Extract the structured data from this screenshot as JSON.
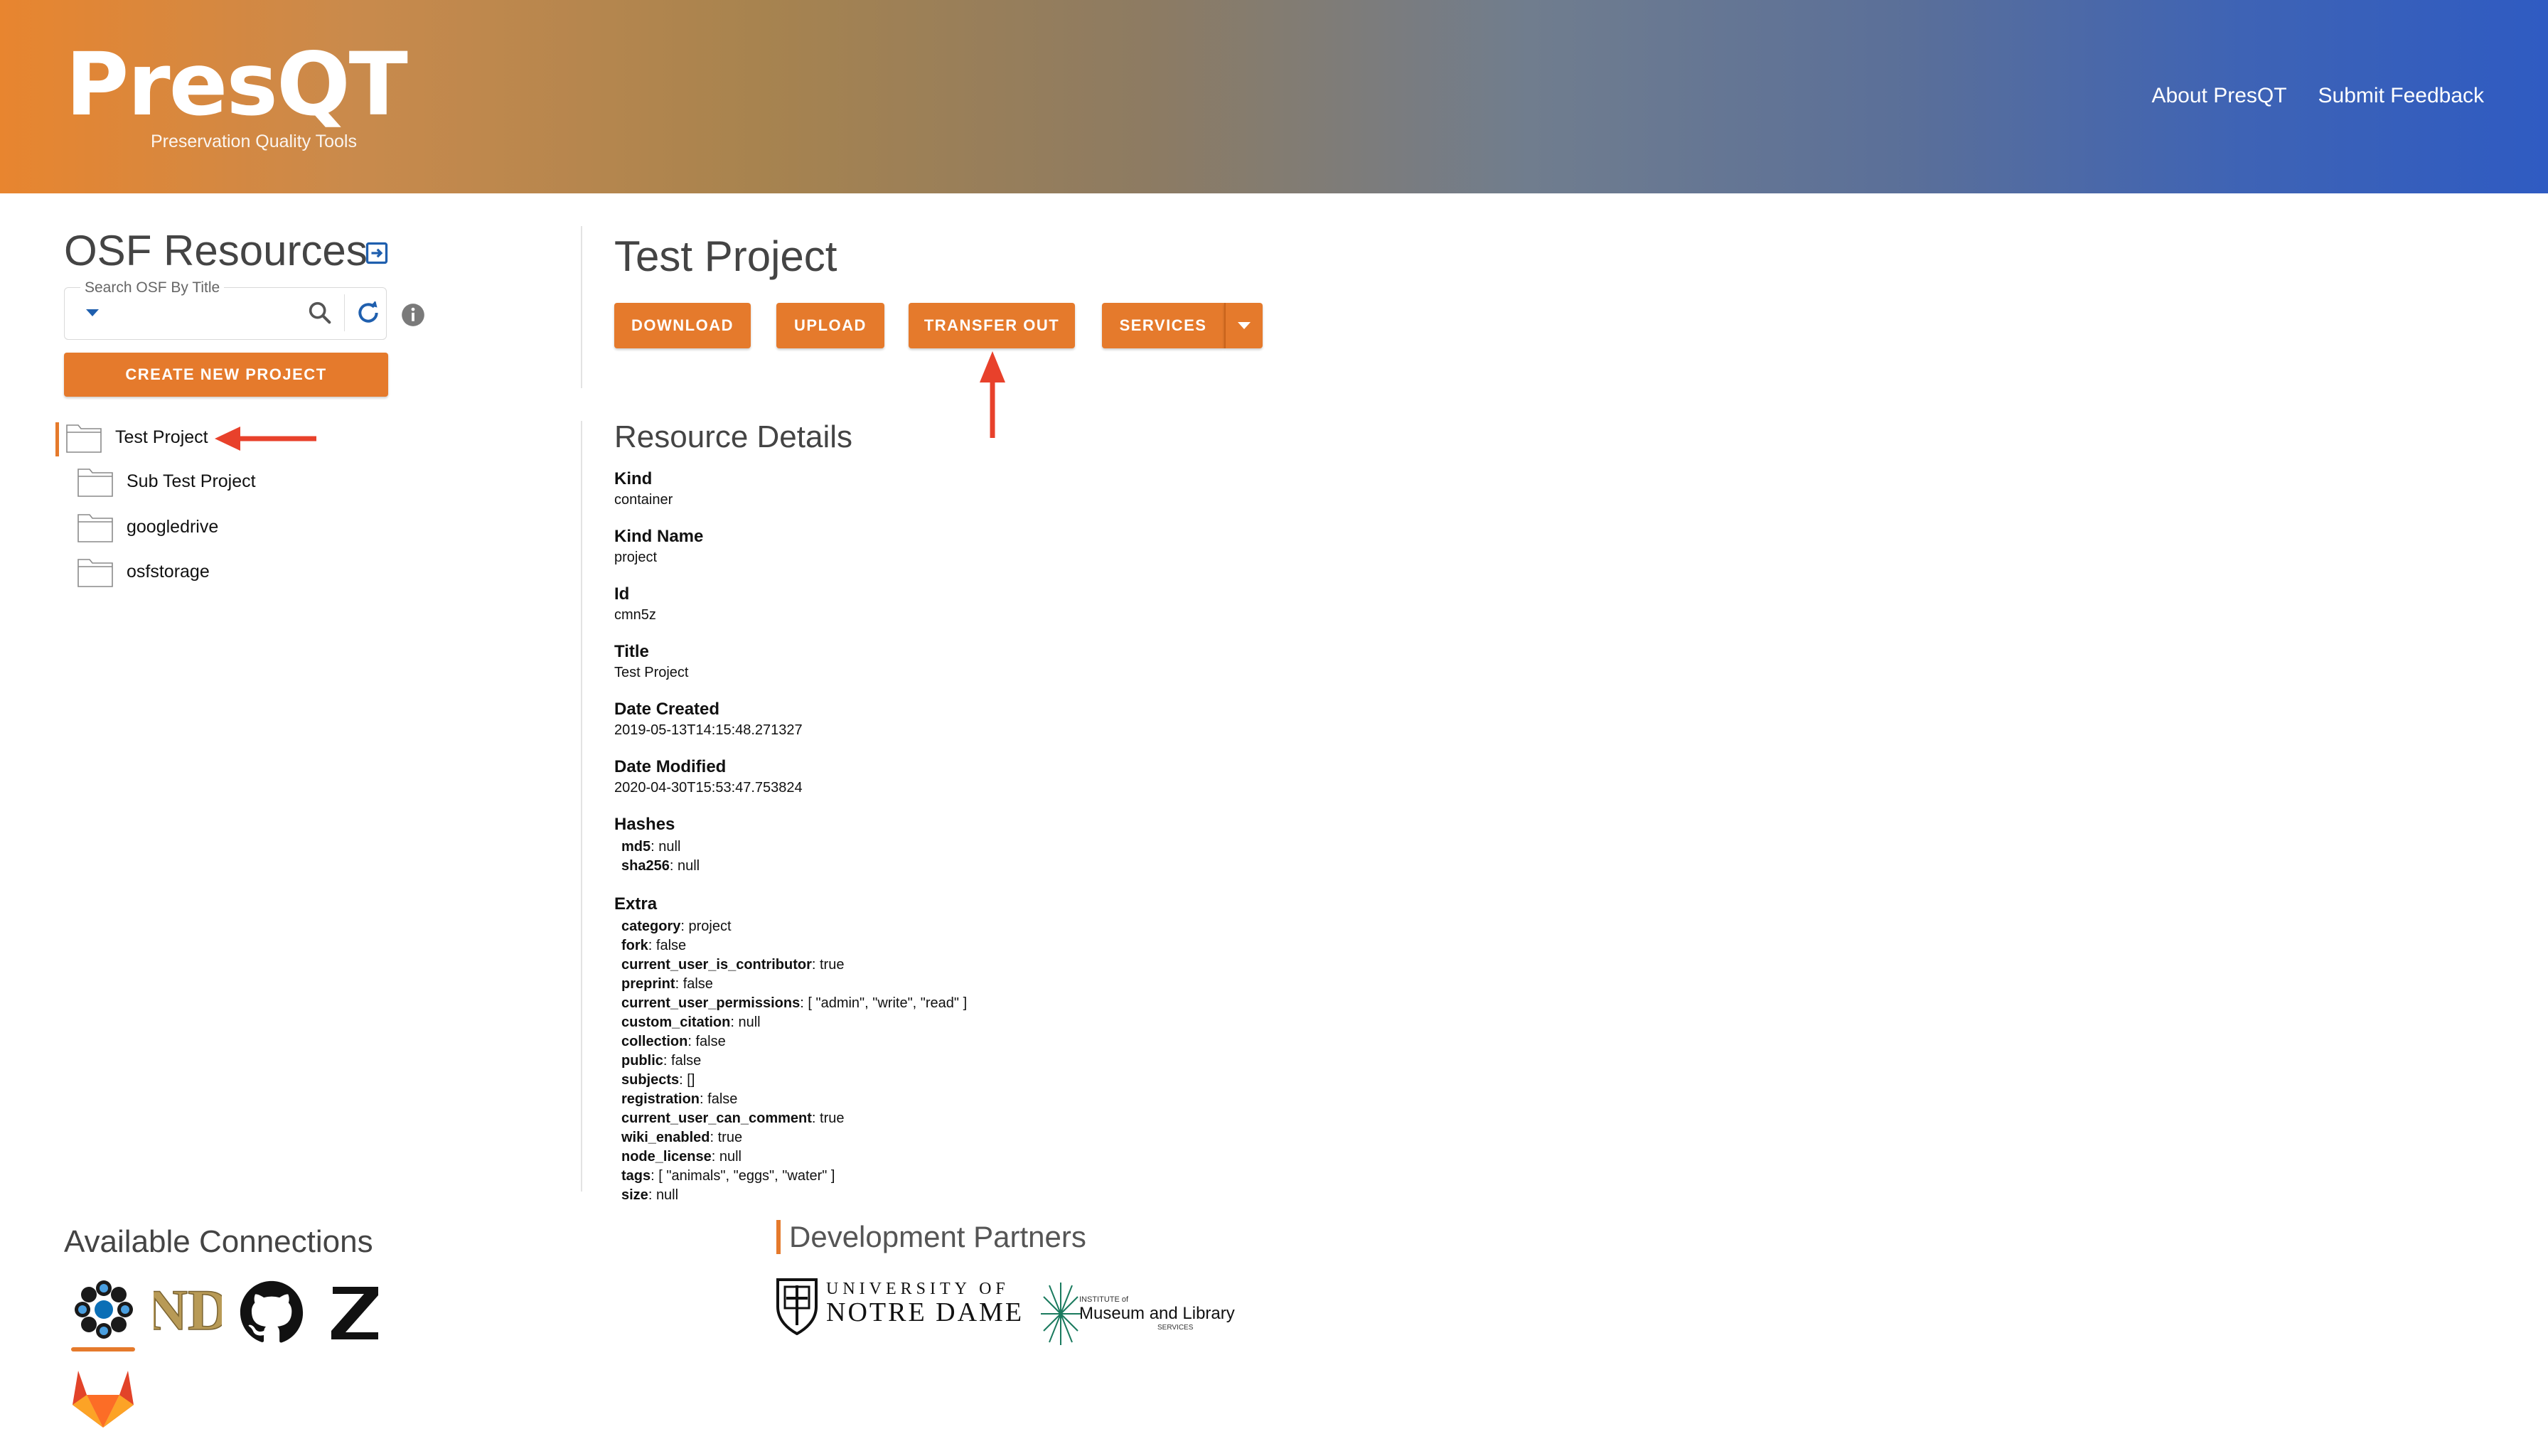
{
  "header": {
    "logo_title": "PresQT",
    "logo_subtitle": "Preservation Quality Tools",
    "nav": [
      "About PresQT",
      "Submit Feedback"
    ]
  },
  "sidebar": {
    "title": "OSF Resources",
    "search_label": "Search OSF By Title",
    "search_placeholder": "",
    "create_button": "CREATE NEW PROJECT",
    "tree": [
      {
        "label": "Test Project",
        "active": true,
        "level": 0
      },
      {
        "label": "Sub Test Project",
        "active": false,
        "level": 1
      },
      {
        "label": "googledrive",
        "active": false,
        "level": 1
      },
      {
        "label": "osfstorage",
        "active": false,
        "level": 1
      }
    ]
  },
  "main": {
    "title": "Test Project",
    "actions": [
      "DOWNLOAD",
      "UPLOAD",
      "TRANSFER OUT",
      "SERVICES"
    ],
    "details_title": "Resource Details",
    "details": [
      {
        "label": "Kind",
        "value": "container"
      },
      {
        "label": "Kind Name",
        "value": "project"
      },
      {
        "label": "Id",
        "value": "cmn5z"
      },
      {
        "label": "Title",
        "value": "Test Project"
      },
      {
        "label": "Date Created",
        "value": "2019-05-13T14:15:48.271327"
      },
      {
        "label": "Date Modified",
        "value": "2020-04-30T15:53:47.753824"
      }
    ],
    "hashes_label": "Hashes",
    "hashes": [
      {
        "key": "md5",
        "value": "null"
      },
      {
        "key": "sha256",
        "value": "null"
      }
    ],
    "extra_label": "Extra",
    "extra": [
      {
        "key": "category",
        "value": "project"
      },
      {
        "key": "fork",
        "value": "false"
      },
      {
        "key": "current_user_is_contributor",
        "value": "true"
      },
      {
        "key": "preprint",
        "value": "false"
      },
      {
        "key": "current_user_permissions",
        "value": "[ \"admin\", \"write\", \"read\" ]"
      },
      {
        "key": "custom_citation",
        "value": "null"
      },
      {
        "key": "collection",
        "value": "false"
      },
      {
        "key": "public",
        "value": "false"
      },
      {
        "key": "subjects",
        "value": "[]"
      },
      {
        "key": "registration",
        "value": "false"
      },
      {
        "key": "current_user_can_comment",
        "value": "true"
      },
      {
        "key": "wiki_enabled",
        "value": "true"
      },
      {
        "key": "node_license",
        "value": "null"
      },
      {
        "key": "tags",
        "value": "[ \"animals\", \"eggs\", \"water\" ]"
      },
      {
        "key": "size",
        "value": "null"
      }
    ]
  },
  "footer": {
    "connections_title": "Available Connections",
    "connections": [
      "osf-icon",
      "notre-dame-icon",
      "github-icon",
      "zenodo-icon",
      "gitlab-icon"
    ],
    "partners_title": "Development Partners",
    "partners": [
      {
        "name": "notre-dame-logo",
        "line1": "UNIVERSITY OF",
        "line2": "NOTRE DAME"
      },
      {
        "name": "imls-logo",
        "line1": "INSTITUTE of",
        "line2": "Museum and Library",
        "line3": "SERVICES"
      }
    ]
  },
  "colors": {
    "accent": "#e57a2c",
    "link_blue": "#1f5fae"
  }
}
